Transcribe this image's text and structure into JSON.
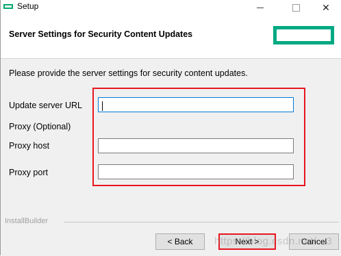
{
  "window": {
    "title": "Setup",
    "icon": "setup-app-icon",
    "controls": {
      "minimize": "minimize-icon",
      "maximize": "maximize-icon",
      "close_glyph": "✕"
    }
  },
  "header": {
    "title": "Server Settings for Security Content Updates",
    "logo": "hpe-logo"
  },
  "main": {
    "intro": "Please provide the server settings for security content updates.",
    "fields": {
      "update_url": {
        "label": "Update server URL",
        "value": ""
      },
      "proxy_section": "Proxy (Optional)",
      "proxy_host": {
        "label": "Proxy host",
        "value": ""
      },
      "proxy_port": {
        "label": "Proxy port",
        "value": ""
      }
    }
  },
  "footer": {
    "brand": "InstallBuilder",
    "buttons": {
      "back": "< Back",
      "next": "Next >",
      "cancel": "Cancel"
    },
    "watermark": "https://blog.csdn.net/...3"
  },
  "colors": {
    "accent_logo": "#01a982",
    "highlight_box": "#e8141e",
    "focus": "#0078d7"
  }
}
